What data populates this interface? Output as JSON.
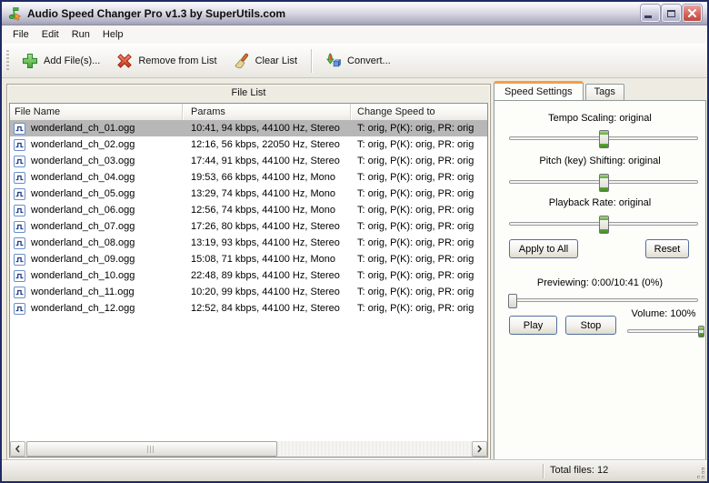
{
  "window": {
    "title": "Audio Speed Changer Pro v1.3 by SuperUtils.com",
    "controls": [
      "minimize",
      "maximize",
      "close"
    ]
  },
  "menu": {
    "items": [
      "File",
      "Edit",
      "Run",
      "Help"
    ]
  },
  "toolbar": {
    "buttons": [
      {
        "label": "Add File(s)...",
        "icon": "add-file-icon"
      },
      {
        "label": "Remove from List",
        "icon": "remove-icon"
      },
      {
        "label": "Clear List",
        "icon": "clear-broom-icon"
      },
      {
        "label": "Convert...",
        "icon": "convert-icon"
      }
    ]
  },
  "file_list": {
    "caption": "File List",
    "columns": [
      "File Name",
      "Params",
      "Change Speed to"
    ],
    "selected_index": 0,
    "rows": [
      {
        "name": "wonderland_ch_01.ogg",
        "params": "10:41, 94 kbps, 44100 Hz, Stereo",
        "change_speed_to": "T: orig, P(K): orig, PR: orig"
      },
      {
        "name": "wonderland_ch_02.ogg",
        "params": "12:16, 56 kbps, 22050 Hz, Stereo",
        "change_speed_to": "T: orig, P(K): orig, PR: orig"
      },
      {
        "name": "wonderland_ch_03.ogg",
        "params": "17:44, 91 kbps, 44100 Hz, Stereo",
        "change_speed_to": "T: orig, P(K): orig, PR: orig"
      },
      {
        "name": "wonderland_ch_04.ogg",
        "params": "19:53, 66 kbps, 44100 Hz, Mono",
        "change_speed_to": "T: orig, P(K): orig, PR: orig"
      },
      {
        "name": "wonderland_ch_05.ogg",
        "params": "13:29, 74 kbps, 44100 Hz, Mono",
        "change_speed_to": "T: orig, P(K): orig, PR: orig"
      },
      {
        "name": "wonderland_ch_06.ogg",
        "params": "12:56, 74 kbps, 44100 Hz, Mono",
        "change_speed_to": "T: orig, P(K): orig, PR: orig"
      },
      {
        "name": "wonderland_ch_07.ogg",
        "params": "17:26, 80 kbps, 44100 Hz, Stereo",
        "change_speed_to": "T: orig, P(K): orig, PR: orig"
      },
      {
        "name": "wonderland_ch_08.ogg",
        "params": "13:19, 93 kbps, 44100 Hz, Stereo",
        "change_speed_to": "T: orig, P(K): orig, PR: orig"
      },
      {
        "name": "wonderland_ch_09.ogg",
        "params": "15:08, 71 kbps, 44100 Hz, Mono",
        "change_speed_to": "T: orig, P(K): orig, PR: orig"
      },
      {
        "name": "wonderland_ch_10.ogg",
        "params": "22:48, 89 kbps, 44100 Hz, Stereo",
        "change_speed_to": "T: orig, P(K): orig, PR: orig"
      },
      {
        "name": "wonderland_ch_11.ogg",
        "params": "10:20, 99 kbps, 44100 Hz, Stereo",
        "change_speed_to": "T: orig, P(K): orig, PR: orig"
      },
      {
        "name": "wonderland_ch_12.ogg",
        "params": "12:52, 84 kbps, 44100 Hz, Stereo",
        "change_speed_to": "T: orig, P(K): orig, PR: orig"
      }
    ]
  },
  "tabs": {
    "active_tab": "Speed Settings",
    "items": [
      {
        "label": "Speed Settings"
      },
      {
        "label": "Tags"
      }
    ]
  },
  "speed_panel": {
    "sliders": [
      {
        "label": "Tempo Scaling: original",
        "position_pct": 50
      },
      {
        "label": "Pitch (key) Shifting: original",
        "position_pct": 50
      },
      {
        "label": "Playback Rate: original",
        "position_pct": 50
      }
    ],
    "apply_label": "Apply to All",
    "reset_label": "Reset",
    "preview": {
      "label": "Previewing: 0:00/10:41 (0%)",
      "position_pct": 2
    },
    "play_label": "Play",
    "stop_label": "Stop",
    "volume": {
      "label": "Volume: 100%",
      "position_pct": 97
    }
  },
  "status_bar": {
    "total_files": "Total files: 12"
  },
  "colors": {
    "accent_tab_orange": "#f0a04a",
    "selection_gray": "#b7b7b7",
    "thumb_green": "#61a839",
    "close_button_red": "#d4655c",
    "button_border_blue": "#53709b",
    "window_border_navy": "#1f2a66"
  }
}
